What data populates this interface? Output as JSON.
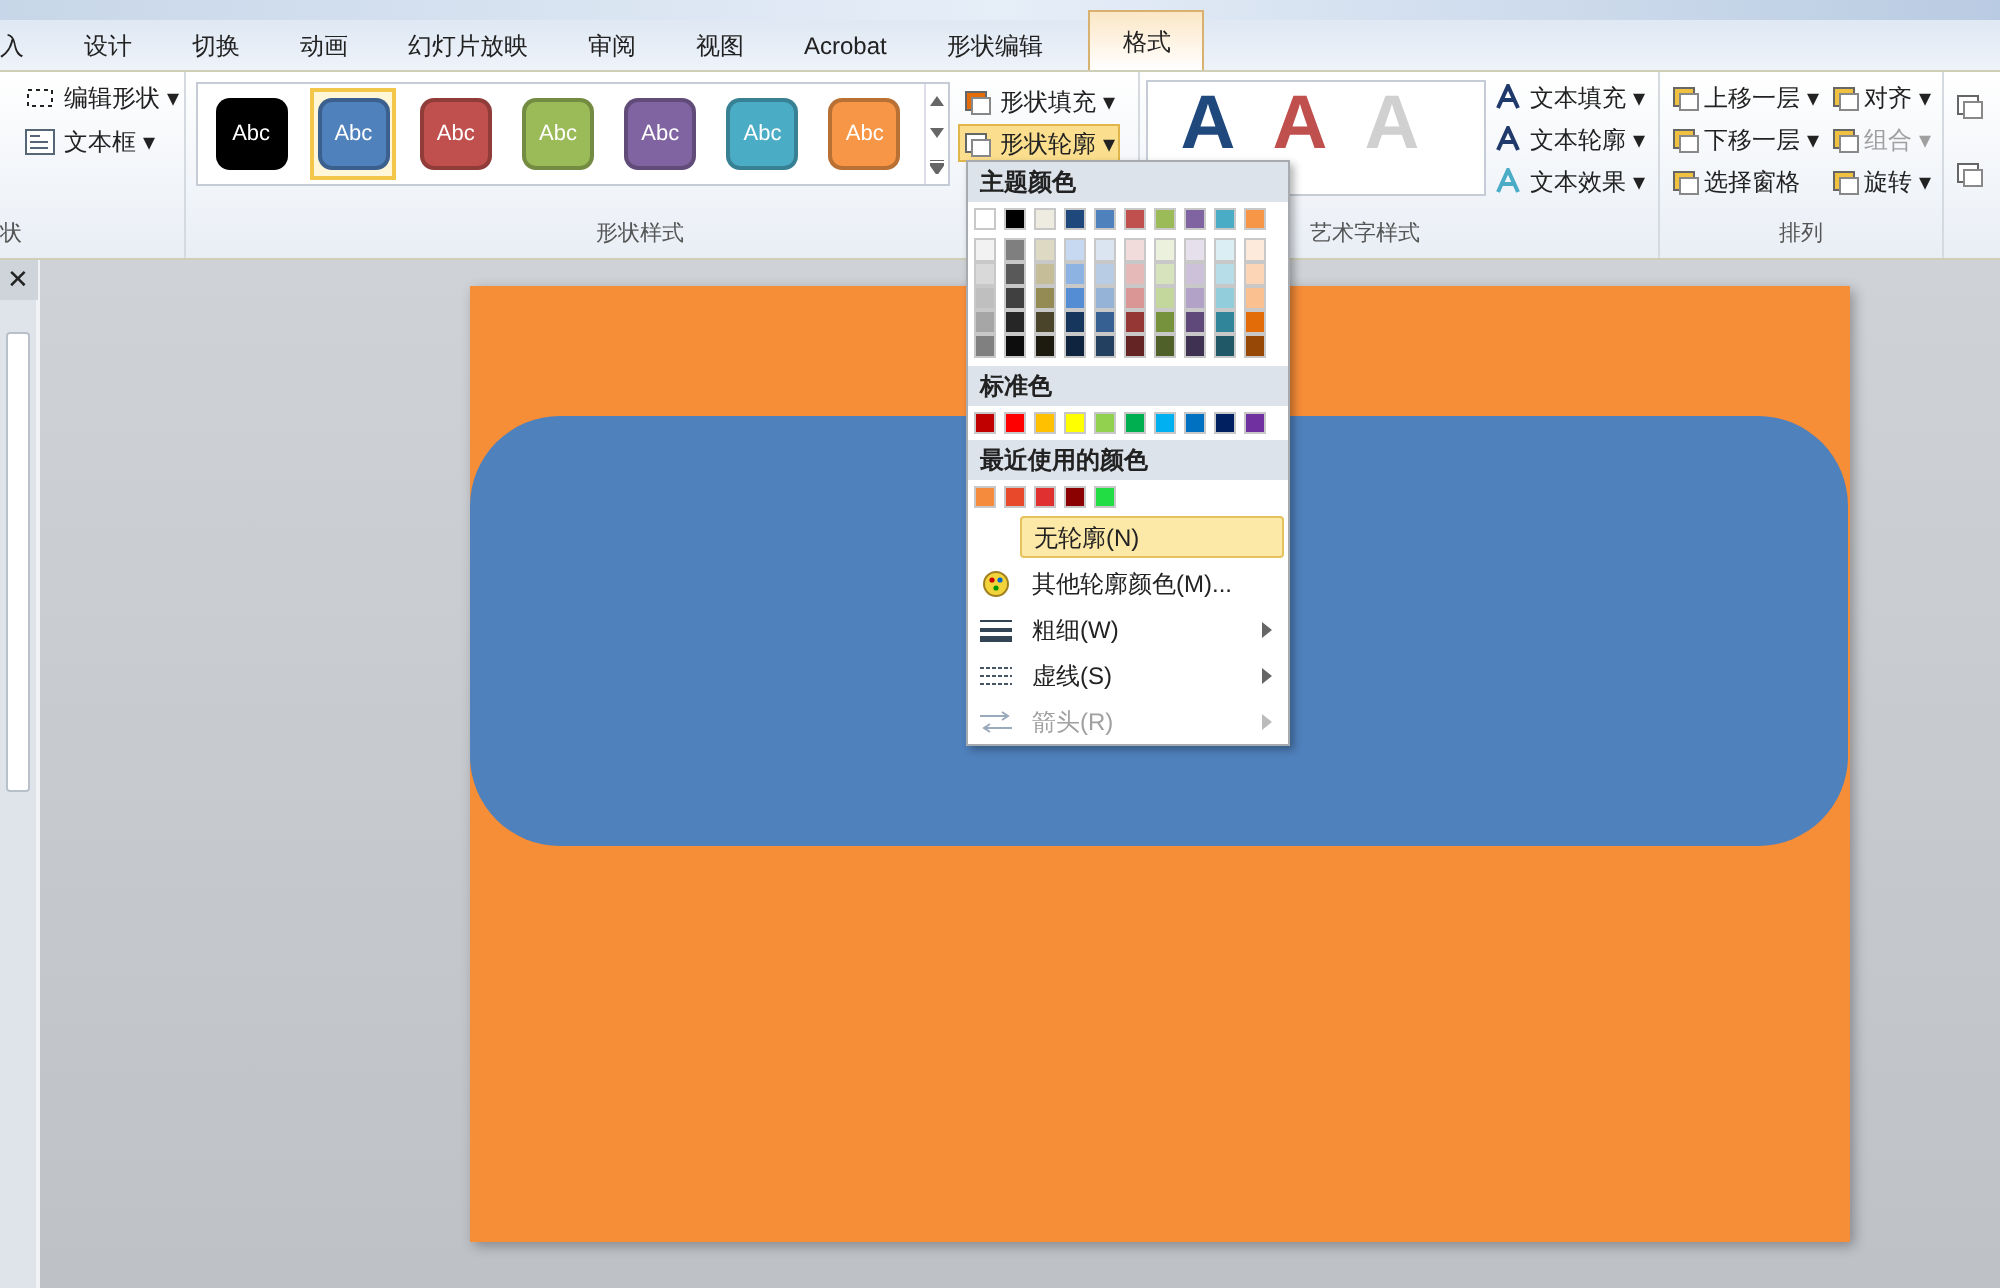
{
  "tabs": [
    {
      "label": "入",
      "selected": false
    },
    {
      "label": "设计",
      "selected": false
    },
    {
      "label": "切换",
      "selected": false
    },
    {
      "label": "动画",
      "selected": false
    },
    {
      "label": "幻灯片放映",
      "selected": false
    },
    {
      "label": "审阅",
      "selected": false
    },
    {
      "label": "视图",
      "selected": false
    },
    {
      "label": "Acrobat",
      "selected": false
    },
    {
      "label": "形状编辑",
      "selected": false
    },
    {
      "label": "格式",
      "selected": true
    }
  ],
  "insert_group": {
    "label": "状",
    "buttons": [
      {
        "label": "编辑形状",
        "caret": "▾"
      },
      {
        "label": "文本框",
        "caret": "▾"
      }
    ]
  },
  "shape_styles": {
    "label": "形状样式",
    "gallery": [
      {
        "text": "Abc",
        "color": "#000000",
        "selected": false
      },
      {
        "text": "Abc",
        "color": "#4f81bd",
        "selected": true
      },
      {
        "text": "Abc",
        "color": "#c0504d",
        "selected": false
      },
      {
        "text": "Abc",
        "color": "#9bbb59",
        "selected": false
      },
      {
        "text": "Abc",
        "color": "#8064a2",
        "selected": false
      },
      {
        "text": "Abc",
        "color": "#4bacc6",
        "selected": false
      },
      {
        "text": "Abc",
        "color": "#f79646",
        "selected": false
      }
    ],
    "buttons": [
      {
        "label": "形状填充",
        "caret": "▾",
        "active": false
      },
      {
        "label": "形状轮廓",
        "caret": "▾",
        "active": true
      }
    ]
  },
  "wordart_styles": {
    "label": "艺术字样式",
    "gallery": [
      {
        "text": "A",
        "color": "#1f497d"
      },
      {
        "text": "A",
        "color": "#c0504d"
      },
      {
        "text": "A",
        "color": "#d0d0d0"
      }
    ],
    "buttons": [
      {
        "label": "文本填充",
        "caret": "▾"
      },
      {
        "label": "文本轮廓",
        "caret": "▾"
      },
      {
        "label": "文本效果",
        "caret": "▾"
      }
    ]
  },
  "arrange": {
    "label": "排列",
    "buttons": [
      {
        "label": "上移一层",
        "caret": "▾",
        "disabled": false
      },
      {
        "label": "对齐",
        "caret": "▾",
        "disabled": false
      },
      {
        "label": "下移一层",
        "caret": "▾",
        "disabled": false
      },
      {
        "label": "组合",
        "caret": "▾",
        "disabled": true
      },
      {
        "label": "选择窗格",
        "disabled": false
      },
      {
        "label": "旋转",
        "caret": "▾",
        "disabled": false
      }
    ]
  },
  "outline_menu": {
    "theme_title": "主题颜色",
    "theme_columns": [
      [
        {
          "color": "#ffffff"
        },
        {
          "color": "#f2f2f2"
        },
        {
          "color": "#d9d9d9"
        },
        {
          "color": "#bfbfbf"
        },
        {
          "color": "#a6a6a6"
        },
        {
          "color": "#808080"
        }
      ],
      [
        {
          "color": "#000000"
        },
        {
          "color": "#7f7f7f"
        },
        {
          "color": "#595959"
        },
        {
          "color": "#404040"
        },
        {
          "color": "#262626"
        },
        {
          "color": "#0d0d0d"
        }
      ],
      [
        {
          "color": "#eeece1"
        },
        {
          "color": "#ddd9c3"
        },
        {
          "color": "#c4bd97"
        },
        {
          "color": "#948a54"
        },
        {
          "color": "#4a452a"
        },
        {
          "color": "#1d1b10"
        }
      ],
      [
        {
          "color": "#1f497d"
        },
        {
          "color": "#c6d9f0"
        },
        {
          "color": "#8db3e2"
        },
        {
          "color": "#548dd4"
        },
        {
          "color": "#17365d"
        },
        {
          "color": "#0f243e"
        }
      ],
      [
        {
          "color": "#4f81bd"
        },
        {
          "color": "#dbe5f1"
        },
        {
          "color": "#b8cce4"
        },
        {
          "color": "#95b3d7"
        },
        {
          "color": "#366092"
        },
        {
          "color": "#244061"
        }
      ],
      [
        {
          "color": "#c0504d"
        },
        {
          "color": "#f2dcdb"
        },
        {
          "color": "#e5b9b7"
        },
        {
          "color": "#d99694"
        },
        {
          "color": "#953734"
        },
        {
          "color": "#632423"
        }
      ],
      [
        {
          "color": "#9bbb59"
        },
        {
          "color": "#ebf1dd"
        },
        {
          "color": "#d7e3bc"
        },
        {
          "color": "#c3d69b"
        },
        {
          "color": "#76923c"
        },
        {
          "color": "#4f6128"
        }
      ],
      [
        {
          "color": "#8064a2"
        },
        {
          "color": "#e5e0ec"
        },
        {
          "color": "#ccc1d9"
        },
        {
          "color": "#b2a2c7"
        },
        {
          "color": "#5f497a"
        },
        {
          "color": "#3f3151"
        }
      ],
      [
        {
          "color": "#4bacc6"
        },
        {
          "color": "#dbeef3"
        },
        {
          "color": "#b7dde8"
        },
        {
          "color": "#92cddc"
        },
        {
          "color": "#31859b"
        },
        {
          "color": "#205867"
        }
      ],
      [
        {
          "color": "#f79646"
        },
        {
          "color": "#fdeada"
        },
        {
          "color": "#fbd5b5"
        },
        {
          "color": "#fac08f"
        },
        {
          "color": "#e36c09"
        },
        {
          "color": "#974806"
        }
      ]
    ],
    "standard_title": "标准色",
    "standard_colors": [
      {
        "color": "#c00000"
      },
      {
        "color": "#ff0000"
      },
      {
        "color": "#ffc000"
      },
      {
        "color": "#ffff00"
      },
      {
        "color": "#92d050"
      },
      {
        "color": "#00b050"
      },
      {
        "color": "#00b0f0"
      },
      {
        "color": "#0070c0"
      },
      {
        "color": "#002060"
      },
      {
        "color": "#7030a0"
      }
    ],
    "recent_title": "最近使用的颜色",
    "recent_colors": [
      {
        "color": "#f58b3c"
      },
      {
        "color": "#e8492a"
      },
      {
        "color": "#e03030"
      },
      {
        "color": "#8b0000"
      },
      {
        "color": "#22dd44"
      }
    ],
    "items": [
      {
        "kind": "plain",
        "label": "无轮廓(N)",
        "selected": true,
        "disabled": false,
        "submenu": false
      },
      {
        "kind": "palette",
        "label": "其他轮廓颜色(M)...",
        "selected": false,
        "disabled": false,
        "submenu": false
      },
      {
        "kind": "weight",
        "label": "粗细(W)",
        "selected": false,
        "disabled": false,
        "submenu": true
      },
      {
        "kind": "dash",
        "label": "虚线(S)",
        "selected": false,
        "disabled": false,
        "submenu": true
      },
      {
        "kind": "arrow",
        "label": "箭头(R)",
        "selected": false,
        "disabled": true,
        "submenu": true
      }
    ]
  },
  "left_pane": {
    "close": "✕"
  }
}
